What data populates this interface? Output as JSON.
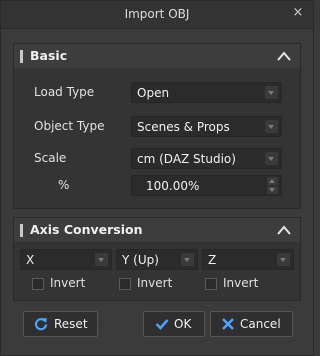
{
  "window": {
    "title": "Import OBJ",
    "close_glyph": "×"
  },
  "basic": {
    "title": "Basic",
    "load_type": {
      "label": "Load Type",
      "value": "Open"
    },
    "object_type": {
      "label": "Object Type",
      "value": "Scenes & Props"
    },
    "scale": {
      "label": "Scale",
      "value": "cm (DAZ Studio)"
    },
    "percent": {
      "label": "%",
      "value": "100.00%"
    }
  },
  "axis": {
    "title": "Axis Conversion",
    "x": {
      "value": "X",
      "invert_label": "Invert"
    },
    "y": {
      "value": "Y (Up)",
      "invert_label": "Invert"
    },
    "z": {
      "value": "Z",
      "invert_label": "Invert"
    }
  },
  "buttons": {
    "reset": "Reset",
    "ok": "OK",
    "cancel": "Cancel"
  },
  "colors": {
    "accent_blue": "#4da3ff",
    "background": "#3b3b3b",
    "field": "#2b2b2b"
  }
}
